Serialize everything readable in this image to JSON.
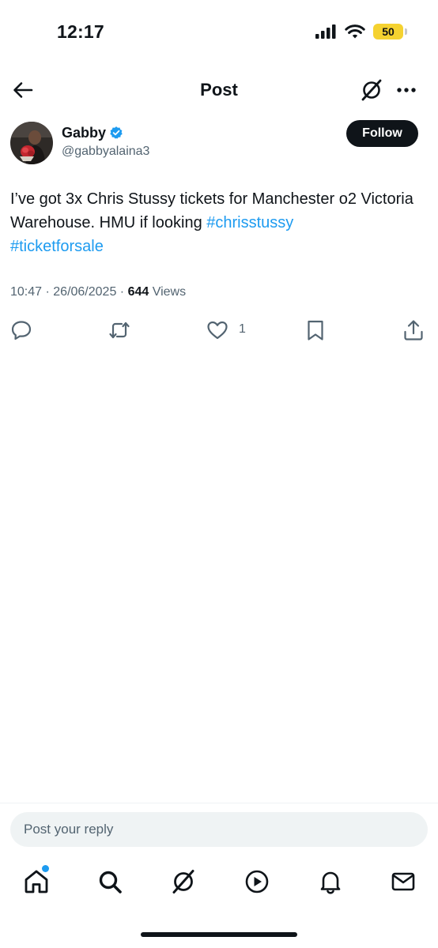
{
  "status_bar": {
    "time": "12:17",
    "battery_level": "50"
  },
  "header": {
    "title": "Post"
  },
  "author": {
    "name": "Gabby",
    "handle": "@gabbyalaina3",
    "verified": true
  },
  "follow_button": {
    "label": "Follow"
  },
  "post": {
    "text": "I’ve got 3x Chris Stussy tickets for Manchester o2 Victoria Warehouse. HMU if looking ",
    "hashtag_1": "#chrisstussy",
    "hashtag_2": "#ticketforsale",
    "time": "10:47",
    "date_sep": " · ",
    "date": "26/06/2025",
    "views_sep": " · ",
    "views_count": "644",
    "views_label": " Views"
  },
  "actions": {
    "like_count": "1"
  },
  "reply": {
    "placeholder": "Post your reply"
  },
  "icons": {
    "back": "arrow-left-icon",
    "grok": "grok-icon",
    "more": "more-horizontal-icon",
    "reply": "reply-icon",
    "repost": "repost-icon",
    "like": "heart-icon",
    "bookmark": "bookmark-icon",
    "share": "share-icon",
    "home": "home-icon",
    "search": "search-icon",
    "notifications": "bell-icon",
    "messages": "mail-icon",
    "video": "play-icon"
  },
  "colors": {
    "accent": "#1d9bf0",
    "text": "#0f1419",
    "secondary": "#536471",
    "battery": "#f5d230"
  }
}
